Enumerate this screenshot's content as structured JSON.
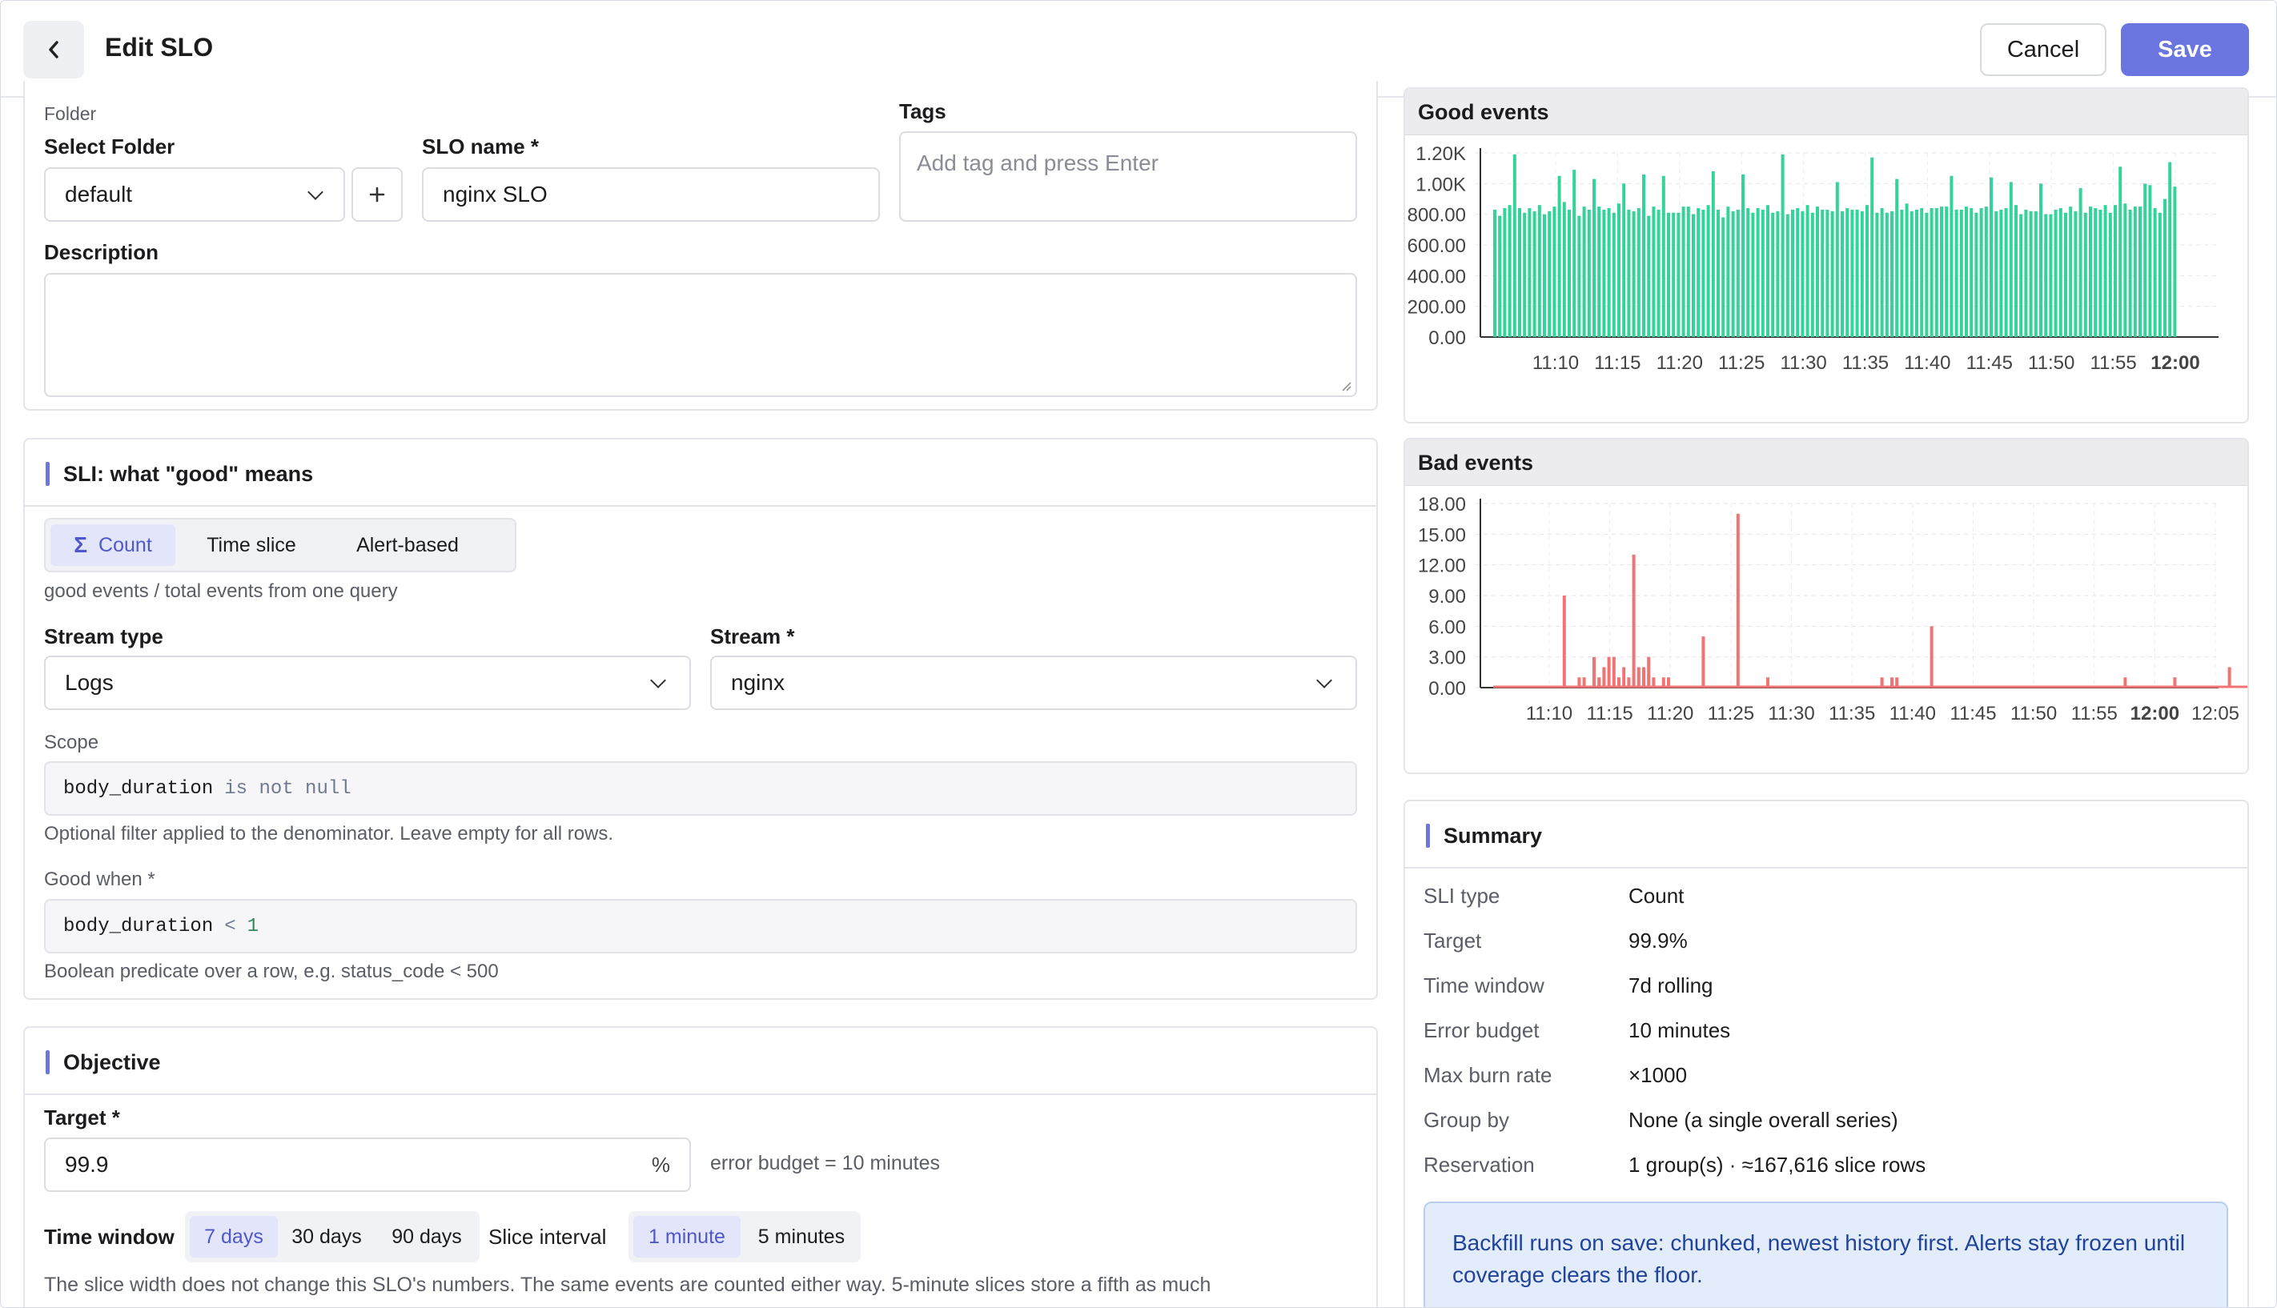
{
  "header": {
    "title": "Edit SLO",
    "cancel_label": "Cancel",
    "save_label": "Save"
  },
  "form": {
    "folder_section_label": "Folder",
    "select_folder_label": "Select Folder",
    "folder_value": "default",
    "slo_name_label": "SLO name *",
    "slo_name_value": "nginx SLO",
    "tags_label": "Tags",
    "tags_placeholder": "Add tag and press Enter",
    "description_label": "Description",
    "description_value": ""
  },
  "sli": {
    "title": "SLI: what \"good\" means",
    "tabs": [
      {
        "label": "Count",
        "active": true
      },
      {
        "label": "Time slice",
        "active": false
      },
      {
        "label": "Alert-based",
        "active": false
      }
    ],
    "count_icon": "Σ",
    "description": "good events / total events from one query",
    "stream_type_label": "Stream type",
    "stream_type_value": "Logs",
    "stream_label": "Stream *",
    "stream_value": "nginx",
    "scope_label": "Scope",
    "scope_field": "body_duration",
    "scope_op": "is not null",
    "scope_hint": "Optional filter applied to the denominator. Leave empty for all rows.",
    "good_when_label": "Good when *",
    "good_field": "body_duration",
    "good_op": "<",
    "good_value": "1",
    "good_hint": "Boolean predicate over a row, e.g. status_code < 500"
  },
  "objective": {
    "title": "Objective",
    "target_label": "Target *",
    "target_value": "99.9",
    "target_unit": "%",
    "error_budget_text": "error budget = 10 minutes",
    "time_window_label": "Time window",
    "time_window_options": [
      {
        "label": "7 days",
        "active": true
      },
      {
        "label": "30 days",
        "active": false
      },
      {
        "label": "90 days",
        "active": false
      }
    ],
    "slice_interval_label": "Slice interval",
    "slice_interval_options": [
      {
        "label": "1 minute",
        "active": true
      },
      {
        "label": "5 minutes",
        "active": false
      }
    ],
    "footnote": "The slice width does not change this SLO's numbers. The same events are counted either way. 5-minute slices store a fifth as much"
  },
  "chart_data": [
    {
      "type": "bar",
      "title": "Good events",
      "color": "#34d399",
      "ylim": [
        0,
        1200
      ],
      "yticks": [
        "1.20K",
        "1.00K",
        "800.00",
        "600.00",
        "400.00",
        "200.00",
        "0.00"
      ],
      "xticks": [
        "11:10",
        "11:15",
        "11:20",
        "11:25",
        "11:30",
        "11:35",
        "11:40",
        "11:45",
        "11:50",
        "11:55",
        "12:00"
      ],
      "xtick_bold": "12:00",
      "values": [
        830,
        790,
        840,
        860,
        1190,
        840,
        810,
        840,
        820,
        860,
        800,
        820,
        850,
        1050,
        880,
        830,
        1090,
        790,
        850,
        830,
        1030,
        850,
        830,
        840,
        810,
        870,
        1000,
        830,
        820,
        840,
        1060,
        790,
        850,
        830,
        1050,
        810,
        810,
        810,
        850,
        850,
        800,
        840,
        830,
        860,
        1080,
        830,
        780,
        850,
        820,
        830,
        1060,
        840,
        810,
        840,
        830,
        860,
        810,
        820,
        1190,
        800,
        830,
        840,
        820,
        860,
        810,
        850,
        830,
        830,
        820,
        1010,
        820,
        840,
        830,
        830,
        820,
        860,
        1170,
        810,
        840,
        810,
        820,
        1030,
        830,
        870,
        820,
        830,
        840,
        810,
        840,
        840,
        850,
        850,
        1050,
        830,
        830,
        850,
        840,
        810,
        840,
        850,
        1040,
        820,
        830,
        840,
        1010,
        860,
        800,
        830,
        820,
        820,
        1000,
        800,
        800,
        830,
        840,
        810,
        850,
        820,
        970,
        810,
        850,
        840,
        830,
        860,
        810,
        860,
        1110,
        870,
        830,
        850,
        850,
        1000,
        990,
        840,
        810,
        900,
        1140,
        980
      ]
    },
    {
      "type": "bar",
      "title": "Bad events",
      "color": "#f17373",
      "ylim": [
        0,
        18
      ],
      "yticks": [
        "18.00",
        "15.00",
        "12.00",
        "9.00",
        "6.00",
        "3.00",
        "0.00"
      ],
      "xticks": [
        "11:10",
        "11:15",
        "11:20",
        "11:25",
        "11:30",
        "11:35",
        "11:40",
        "11:45",
        "11:50",
        "11:55",
        "12:00",
        "12:05"
      ],
      "xtick_bold": "12:00",
      "values": [
        0,
        0,
        0,
        0,
        0,
        0,
        0,
        0,
        0,
        0,
        0,
        0,
        0,
        0,
        9,
        0,
        0,
        1,
        1,
        0,
        3,
        1,
        2,
        3,
        3,
        1,
        2,
        1,
        13,
        2,
        2,
        3,
        1,
        0,
        1,
        1,
        0,
        0,
        0,
        0,
        0,
        0,
        5,
        0,
        0,
        0,
        0,
        0,
        0,
        17,
        0,
        0,
        0,
        0,
        0,
        1,
        0,
        0,
        0,
        0,
        0,
        0,
        0,
        0,
        0,
        0,
        0,
        0,
        0,
        0,
        0,
        0,
        0,
        0,
        0,
        0,
        0,
        0,
        1,
        0,
        1,
        1,
        0,
        0,
        0,
        0,
        0,
        0,
        6,
        0,
        0,
        0,
        0,
        0,
        0,
        0,
        0,
        0,
        0,
        0,
        0,
        0,
        0,
        0,
        0,
        0,
        0,
        0,
        0,
        0,
        0,
        0,
        0,
        0,
        0,
        0,
        0,
        0,
        0,
        0,
        0,
        0,
        0,
        0,
        0,
        0,
        0,
        1,
        0,
        0,
        0,
        0,
        0,
        0,
        0,
        0,
        0,
        1,
        0,
        0,
        0,
        0,
        0,
        0,
        0,
        0,
        0,
        0,
        2,
        0,
        0,
        0
      ]
    }
  ],
  "summary": {
    "title": "Summary",
    "rows": [
      {
        "key": "SLI type",
        "value": "Count"
      },
      {
        "key": "Target",
        "value": "99.9%"
      },
      {
        "key": "Time window",
        "value": "7d rolling"
      },
      {
        "key": "Error budget",
        "value": "10 minutes"
      },
      {
        "key": "Max burn rate",
        "value": "×1000"
      },
      {
        "key": "Group by",
        "value": "None (a single overall series)"
      },
      {
        "key": "Reservation",
        "value": "1 group(s) · ≈167,616 slice rows"
      }
    ],
    "note": "Backfill runs on save: chunked, newest history first. Alerts stay frozen until coverage clears the floor."
  },
  "icons": {
    "back": "chevron-left-icon",
    "folder_dropdown": "chevron-down-icon",
    "add_folder": "plus-icon",
    "count": "sigma-icon"
  },
  "colors": {
    "accent": "#6b75e0",
    "good": "#34d399",
    "bad": "#f17373",
    "note_bg": "#e2ecfb"
  }
}
